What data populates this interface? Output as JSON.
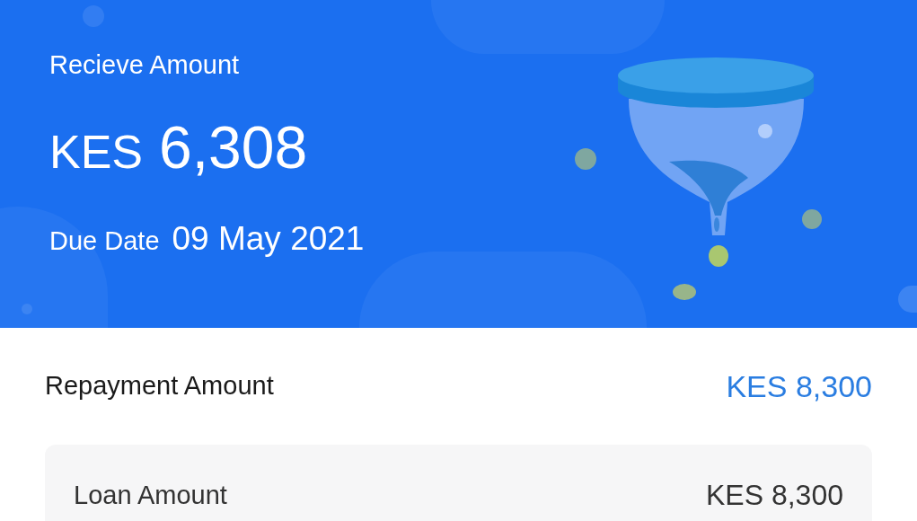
{
  "header": {
    "receive_label": "Recieve Amount",
    "currency": "KES",
    "amount": "6,308",
    "due_label": "Due Date",
    "due_date": "09 May 2021"
  },
  "repayment": {
    "label": "Repayment Amount",
    "value": "KES 8,300"
  },
  "details": [
    {
      "label": "Loan Amount",
      "value": "KES 8,300"
    }
  ]
}
